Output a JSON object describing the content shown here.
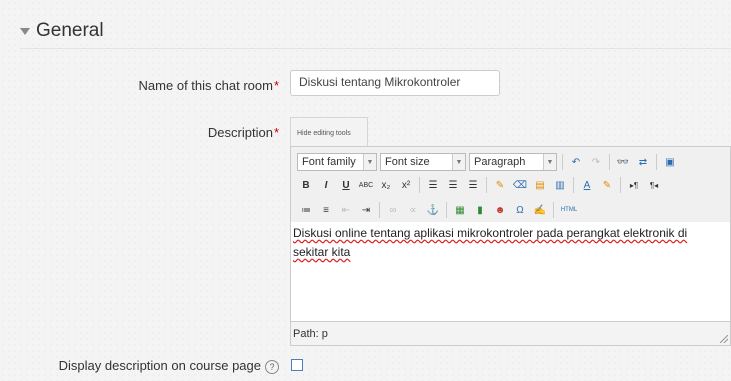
{
  "section": {
    "title": "General"
  },
  "fields": {
    "name_label": "Name of this chat room",
    "name_value": "Diskusi tentang Mikrokontroler",
    "description_label": "Description",
    "required_marker": "*",
    "display_label": "Display description on course page",
    "help_icon": "?"
  },
  "editor": {
    "toggle_tab": "Hide editing tools",
    "font_family": "Font family",
    "font_size": "Font size",
    "format": "Paragraph",
    "content_line1_pre": "Diskusi online ",
    "content_line1_rest": "tentang aplikasi mikrokontroler pada perangkat elektronik di",
    "content_line2": "sekitar kita",
    "path": "Path: p",
    "html_button": "HTML"
  },
  "icons": [
    "collapse-icon",
    "undo-icon",
    "redo-icon",
    "find-icon",
    "replace-icon",
    "fullscreen-icon",
    "bold-icon",
    "italic-icon",
    "underline-icon",
    "strikethrough-icon",
    "subscript-icon",
    "superscript-icon",
    "align-left-icon",
    "align-center-icon",
    "align-right-icon",
    "cleanup-icon",
    "eraser-icon",
    "paste-text-icon",
    "paste-word-icon",
    "text-color-icon",
    "highlight-icon",
    "ltr-icon",
    "rtl-icon",
    "bullet-list-icon",
    "number-list-icon",
    "outdent-icon",
    "indent-icon",
    "link-icon",
    "unlink-icon",
    "anchor-icon",
    "image-icon",
    "media-icon",
    "emoticon-icon",
    "special-char-icon",
    "edit-icon",
    "html-icon",
    "help-icon",
    "checkbox"
  ]
}
